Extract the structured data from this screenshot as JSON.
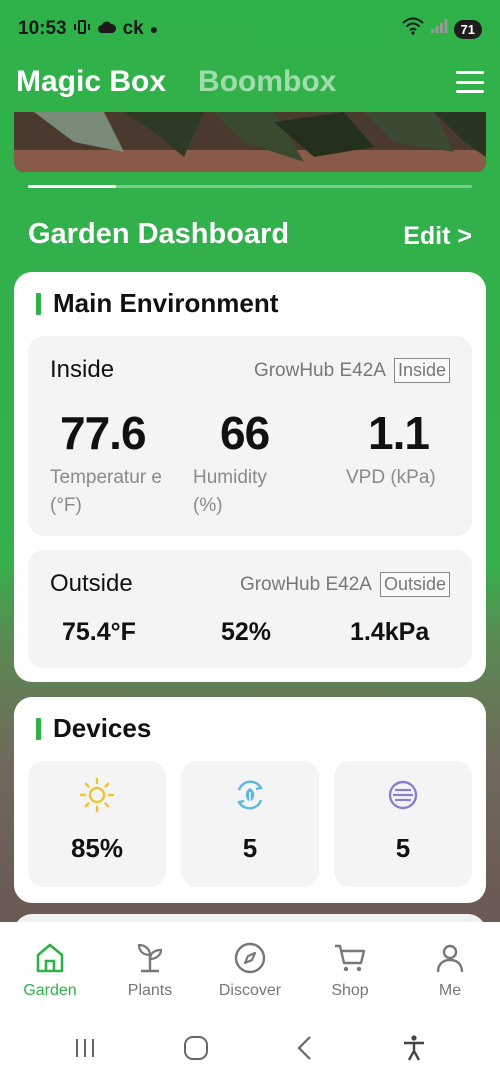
{
  "status_bar": {
    "time": "10:53",
    "carrier": "ck",
    "battery": "71"
  },
  "header": {
    "title_primary": "Magic Box",
    "title_secondary": "Boombox"
  },
  "dashboard": {
    "title": "Garden Dashboard",
    "edit_label": "Edit >"
  },
  "main_environment": {
    "title": "Main Environment",
    "inside": {
      "label": "Inside",
      "device": "GrowHub E42A",
      "tag": "Inside",
      "temperature_value": "77.6",
      "temperature_label": "Temperatur e (°F)",
      "humidity_value": "66",
      "humidity_label": "Humidity (%)",
      "vpd_value": "1.1",
      "vpd_label": "VPD (kPa)"
    },
    "outside": {
      "label": "Outside",
      "device": "GrowHub E42A",
      "tag": "Outside",
      "temperature": "75.4°F",
      "humidity": "52%",
      "vpd": "1.4kPa"
    }
  },
  "devices": {
    "title": "Devices",
    "items": [
      {
        "icon": "sun-icon",
        "value": "85%",
        "color": "#f2c230"
      },
      {
        "icon": "fan-leaf-icon",
        "value": "5",
        "color": "#5ab8e0"
      },
      {
        "icon": "vent-lines-icon",
        "value": "5",
        "color": "#8a7fd0"
      }
    ]
  },
  "tabs": [
    {
      "label": "Garden",
      "icon": "home-icon",
      "active": true
    },
    {
      "label": "Plants",
      "icon": "sprout-icon",
      "active": false
    },
    {
      "label": "Discover",
      "icon": "compass-icon",
      "active": false
    },
    {
      "label": "Shop",
      "icon": "cart-icon",
      "active": false
    },
    {
      "label": "Me",
      "icon": "person-icon",
      "active": false
    }
  ],
  "colors": {
    "accent": "#2fb14a",
    "inactive_tab": "#777777"
  }
}
